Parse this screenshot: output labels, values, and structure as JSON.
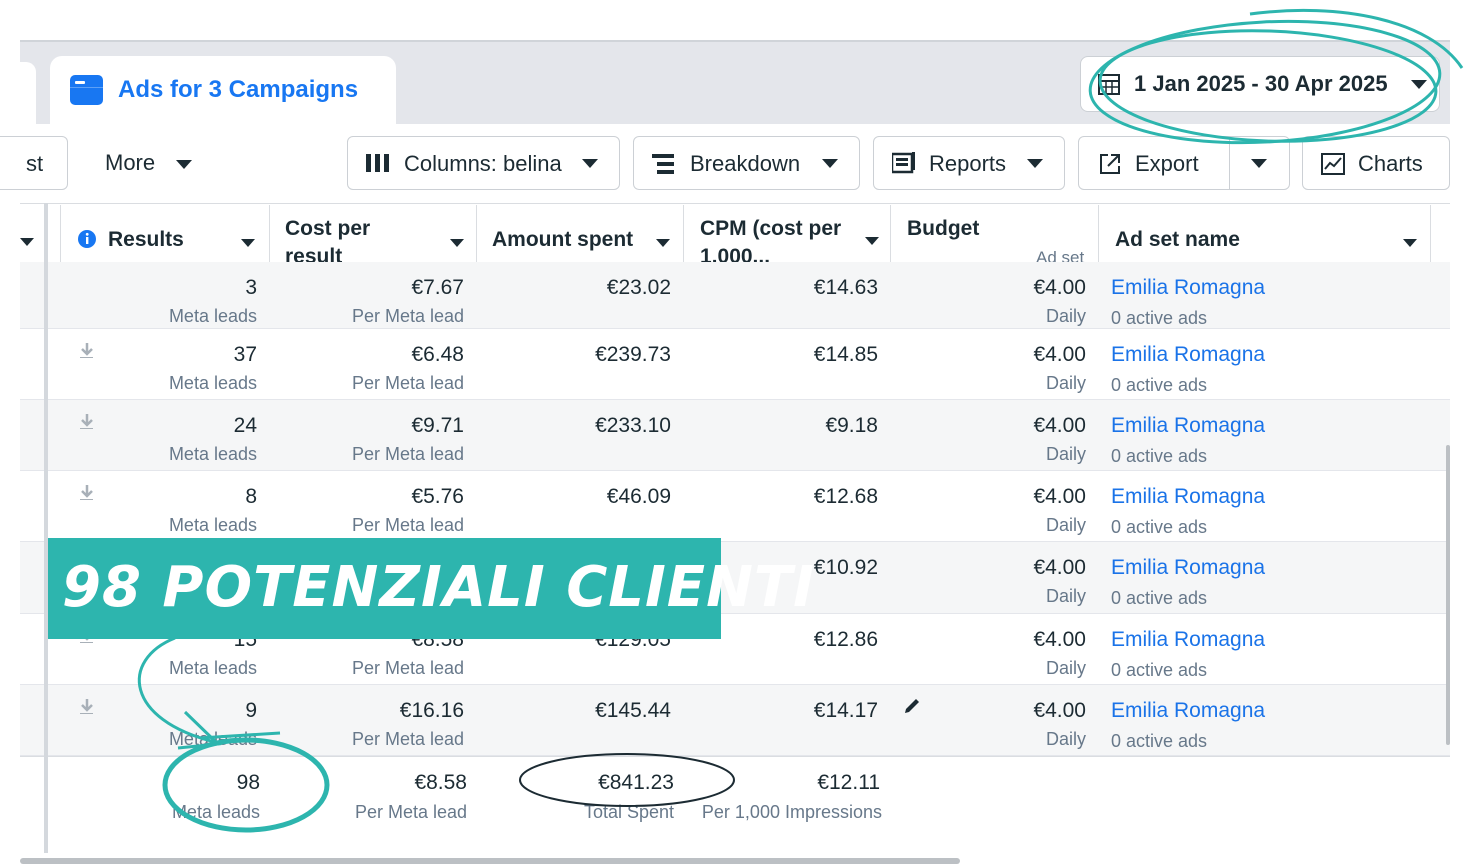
{
  "tabs": {
    "active_label": "Ads for 3 Campaigns"
  },
  "date_range": {
    "label": "1 Jan 2025 - 30 Apr 2025"
  },
  "toolbar": {
    "partial_label": "st",
    "more_label": "More",
    "columns_label": "Columns: belina",
    "breakdown_label": "Breakdown",
    "reports_label": "Reports",
    "export_label": "Export",
    "charts_label": "Charts"
  },
  "table": {
    "headers": {
      "results": "Results",
      "cost_per_result_1": "Cost per",
      "cost_per_result_2": "result",
      "amount_spent": "Amount spent",
      "cpm_1": "CPM (cost per",
      "cpm_2": "1,000...",
      "budget": "Budget",
      "budget_sub": "Ad set",
      "ad_set_name": "Ad set name"
    },
    "rows": [
      {
        "results": "3",
        "results_sub": "Meta leads",
        "cpr": "€7.67",
        "cpr_sub": "Per Meta lead",
        "spent": "€23.02",
        "cpm": "€14.63",
        "budget": "€4.00",
        "budget_sub": "Daily",
        "name": "Emilia Romagna",
        "name_sub": "0 active ads"
      },
      {
        "results": "37",
        "results_sub": "Meta leads",
        "cpr": "€6.48",
        "cpr_sub": "Per Meta lead",
        "spent": "€239.73",
        "cpm": "€14.85",
        "budget": "€4.00",
        "budget_sub": "Daily",
        "name": "Emilia Romagna",
        "name_sub": "0 active ads"
      },
      {
        "results": "24",
        "results_sub": "Meta leads",
        "cpr": "€9.71",
        "cpr_sub": "Per Meta lead",
        "spent": "€233.10",
        "cpm": "€9.18",
        "budget": "€4.00",
        "budget_sub": "Daily",
        "name": "Emilia Romagna",
        "name_sub": "0 active ads"
      },
      {
        "results": "8",
        "results_sub": "Meta leads",
        "cpr": "€5.76",
        "cpr_sub": "Per Meta lead",
        "spent": "€46.09",
        "cpm": "€12.68",
        "budget": "€4.00",
        "budget_sub": "Daily",
        "name": "Emilia Romagna",
        "name_sub": "0 active ads"
      },
      {
        "results": "",
        "results_sub": "",
        "cpr": "",
        "cpr_sub": "",
        "spent": "",
        "cpm": "€10.92",
        "budget": "€4.00",
        "budget_sub": "Daily",
        "name": "Emilia Romagna",
        "name_sub": "0 active ads"
      },
      {
        "results": "15",
        "results_sub": "Meta leads",
        "cpr": "€8.58",
        "cpr_sub": "Per Meta lead",
        "spent": "€129.05",
        "cpm": "€12.86",
        "budget": "€4.00",
        "budget_sub": "Daily",
        "name": "Emilia Romagna",
        "name_sub": "0 active ads"
      },
      {
        "results": "9",
        "results_sub": "Meta leads",
        "cpr": "€16.16",
        "cpr_sub": "Per Meta lead",
        "spent": "€145.44",
        "cpm": "€14.17",
        "budget": "€4.00",
        "budget_sub": "Daily",
        "name": "Emilia Romagna",
        "name_sub": "0 active ads"
      }
    ],
    "totals": {
      "results": "98",
      "results_sub": "Meta leads",
      "cpr": "€8.58",
      "cpr_sub": "Per Meta lead",
      "spent": "€841.23",
      "spent_sub": "Total Spent",
      "cpm": "€12.11",
      "cpm_sub": "Per 1,000 Impressions"
    }
  },
  "overlay": {
    "banner_text": "98 POTENZIALI CLIENTI"
  },
  "colors": {
    "accent": "#1877f2",
    "annotation": "#2db5ae",
    "link": "#1a73e8"
  }
}
